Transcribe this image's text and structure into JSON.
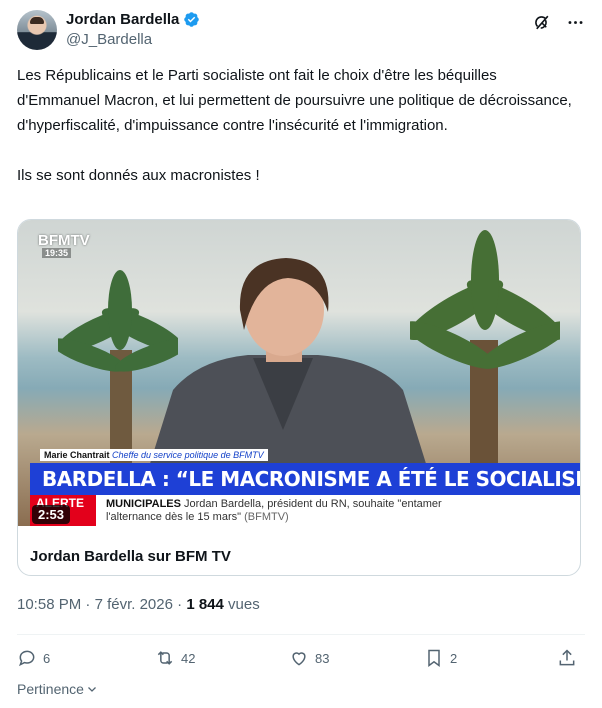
{
  "author": {
    "display_name": "Jordan Bardella",
    "handle": "@J_Bardella"
  },
  "tweet": {
    "paragraph1": "Les Républicains et le Parti socialiste ont fait le choix d'être les béquilles d'Emmanuel Macron, et lui permettent de poursuivre une politique de décroissance, d'hyperfiscalité, d'impuissance contre l'insécurité et l'immigration.",
    "paragraph2": "Ils se sont donnés aux macronistes !"
  },
  "media": {
    "channel_logo": "BFMTV",
    "clock": "19:35",
    "guest_name": "Marie Chantrait",
    "guest_role": "Cheffe du service politique de BFMTV",
    "banner": "BARDELLA : “LE MACRONISME A ÉTÉ LE SOCIALISME EN PIRE”",
    "ticker_alert": "ALERTE",
    "ticker_category": "MUNICIPALES",
    "ticker_text": "Jordan Bardella, président du RN, souhaite \"entamer l'alternance dès le 15 mars\"",
    "ticker_source": "(BFMTV)",
    "duration": "2:53",
    "card_title": "Jordan Bardella sur BFM TV"
  },
  "meta": {
    "time": "10:58 PM",
    "separator": "·",
    "date": "7 févr. 2026",
    "views_count": "1 844",
    "views_label": "vues"
  },
  "actions": {
    "replies": "6",
    "reposts": "42",
    "likes": "83",
    "bookmarks": "2"
  },
  "relevance_label": "Pertinence",
  "colors": {
    "banner_blue": "#1e40d6",
    "verified_blue": "#1d9bf0",
    "alert_red": "#e3001b",
    "secondary_text": "#536471"
  },
  "icons": [
    "verified-badge-icon",
    "grok-icon",
    "more-icon",
    "reply-icon",
    "repost-icon",
    "like-icon",
    "bookmark-icon",
    "share-icon",
    "chevron-down-icon"
  ]
}
